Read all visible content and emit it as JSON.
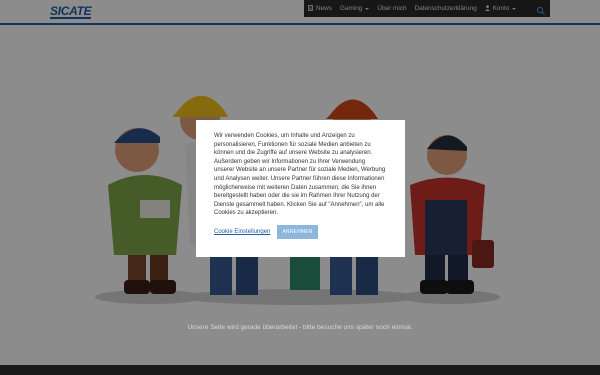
{
  "site": {
    "logo_text": "SICATE",
    "brand_color": "#1f5fa8"
  },
  "nav": {
    "items": [
      {
        "label": "News",
        "icon": "document-icon",
        "has_caret": false
      },
      {
        "label": "Gaming",
        "icon": "",
        "has_caret": true
      },
      {
        "label": "Über mich",
        "icon": "",
        "has_caret": false
      },
      {
        "label": "Datenschutzerklärung",
        "icon": "",
        "has_caret": false
      },
      {
        "label": "Konto",
        "icon": "user-icon",
        "has_caret": true
      }
    ],
    "search_icon": "search-icon",
    "background": "#2b2b2b"
  },
  "hero": {
    "description_icon": "construction-workers-figurines"
  },
  "maintenance": {
    "text": "Unsere Seite wird gerade überarbeitet - bitte besuche uns später noch einmal."
  },
  "cookie_banner": {
    "text": "Wir verwenden Cookies, um Inhalte und Anzeigen zu personalisieren, Funktionen für soziale Medien anbieten zu können und die Zugriffe auf unsere Website zu analysieren. Außerdem geben wir Informationen zu Ihrer Verwendung unserer Website an unsere Partner für soziale Medien, Werbung und Analysen weiter. Unsere Partner führen diese Informationen möglicherweise mit weiteren Daten zusammen, die Sie ihnen bereitgestellt haben oder die sie im Rahmen Ihrer Nutzung der Dienste gesammelt haben. Klicken Sie auf \"Annehmen\", um alle Cookies zu akzeptieren.",
    "settings_label": "Cookie Einstellungen",
    "accept_label": "ANNEHMEN",
    "accept_color": "#8cb6db"
  }
}
